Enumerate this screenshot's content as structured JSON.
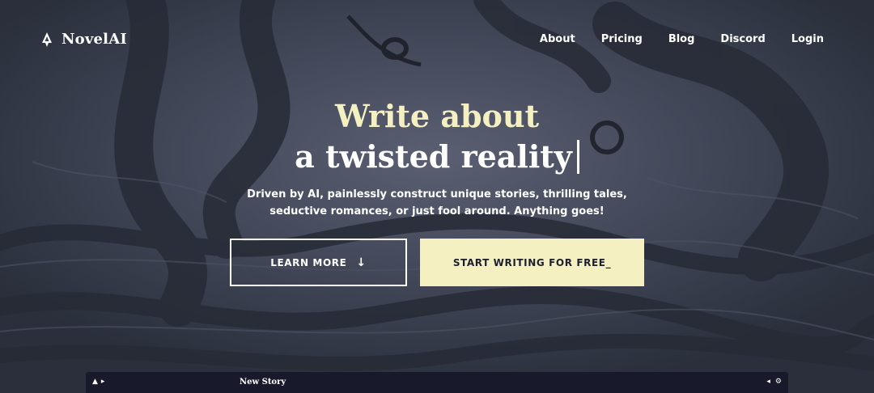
{
  "brand": {
    "name": "NovelAI"
  },
  "nav": {
    "items": [
      "About",
      "Pricing",
      "Blog",
      "Discord",
      "Login"
    ]
  },
  "hero": {
    "line1": "Write about",
    "line2": "a twisted reality",
    "description_line1": "Driven by AI, painlessly construct unique stories, thrilling tales,",
    "description_line2": "seductive romances, or just fool around. Anything goes!"
  },
  "buttons": {
    "learn_more": "LEARN MORE",
    "start_writing": "START WRITING FOR FREE_"
  },
  "editor": {
    "title": "New Story",
    "left_icons": [
      "quill-icon",
      "chevron-right-icon"
    ],
    "right_icons": [
      "chevron-left-icon",
      "gear-icon"
    ]
  },
  "colors": {
    "accent": "#f5f0c1",
    "editor_bar": "#181a2c",
    "background": "#3b4150"
  }
}
